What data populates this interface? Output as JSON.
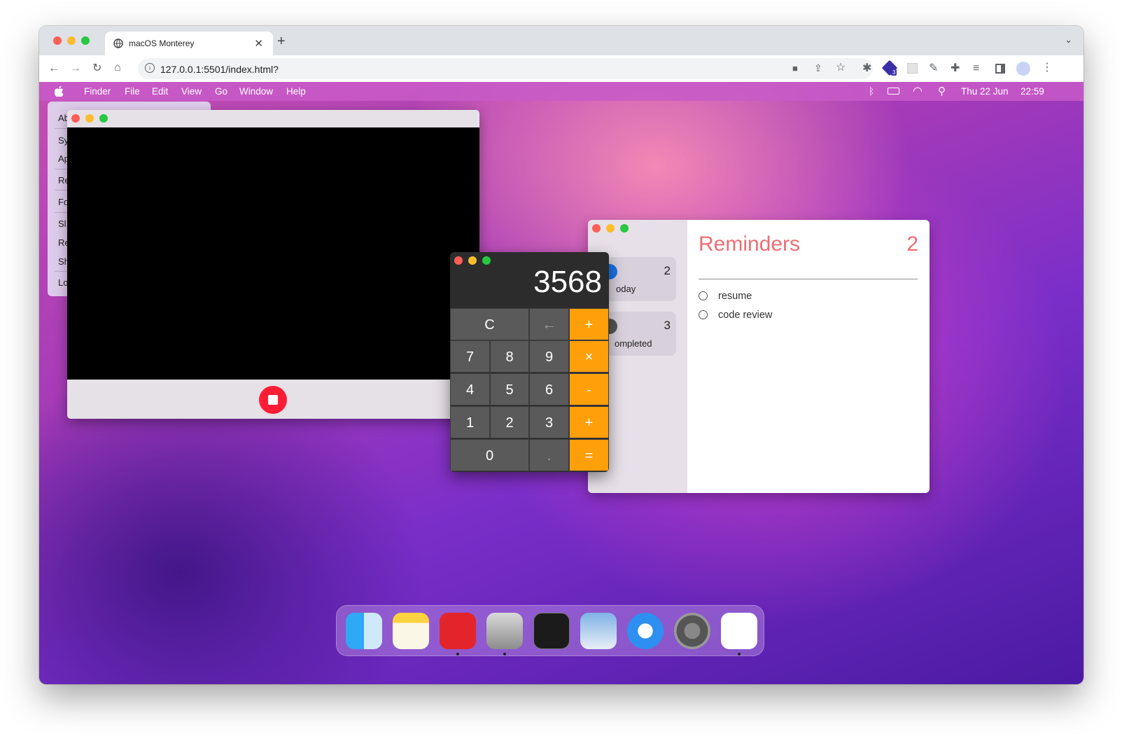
{
  "browser": {
    "tab_title": "macOS Monterey",
    "url": "127.0.0.1:5501/index.html?",
    "extension_badge": "3"
  },
  "menubar": {
    "apple_icon": "apple-icon",
    "items": [
      "Finder",
      "File",
      "Edit",
      "View",
      "Go",
      "Window",
      "Help"
    ],
    "date": "Thu 22 Jun",
    "time": "22:59"
  },
  "apple_menu": {
    "items": [
      "Ab",
      "Sy",
      "Ap",
      "Re",
      "Fo",
      "Sl",
      "Re",
      "Sh",
      "Lo"
    ]
  },
  "camera_window": {
    "stop_icon": "stop-record-icon"
  },
  "reminders": {
    "title": "Reminders",
    "count": "2",
    "sidebar": [
      {
        "label": "oday",
        "count": "2",
        "icon": "calendar-icon",
        "color": "#1a73e8"
      },
      {
        "label": "ompleted",
        "count": "3",
        "icon": "tray-icon",
        "color": "#555555"
      }
    ],
    "items": [
      "resume",
      "code review"
    ]
  },
  "calculator": {
    "display": "3568",
    "keys": [
      [
        "C",
        "←",
        "+"
      ],
      [
        "7",
        "8",
        "9",
        "×"
      ],
      [
        "4",
        "5",
        "6",
        "-"
      ],
      [
        "1",
        "2",
        "3",
        "+"
      ],
      [
        "0",
        ".",
        "="
      ]
    ]
  },
  "dock": {
    "apps": [
      "finder-icon",
      "notes-icon",
      "photo-booth-icon",
      "calculator-icon",
      "terminal-icon",
      "preview-icon",
      "safari-icon",
      "system-preferences-icon",
      "reminders-icon"
    ]
  },
  "colors": {
    "accent_orange": "#ff9f0a",
    "reminders_red": "#ee6e73",
    "record_red": "#ff1d35"
  }
}
